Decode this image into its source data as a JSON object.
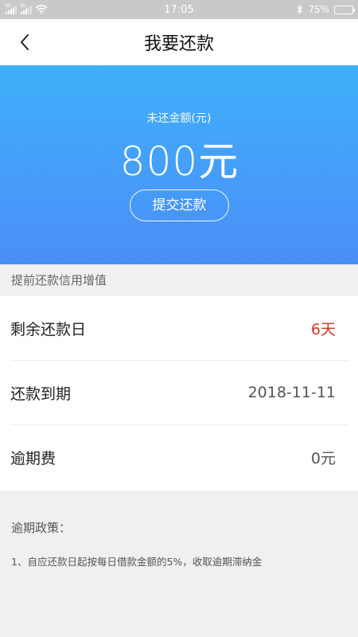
{
  "status_bar": {
    "time": "17:05",
    "battery": "75%",
    "sim1_label": "4G",
    "sim2_label": "3G",
    "battery_level": 0.75,
    "colors": {
      "bar": "#c9c9c9",
      "battery_fill": "#4cd964"
    }
  },
  "nav": {
    "title": "我要还款",
    "back_icon": "chevron-left-icon"
  },
  "hero": {
    "label": "未还金额(元)",
    "amount": "800",
    "unit": "元",
    "submit_label": "提交还款",
    "colors": {
      "gradient_top": "#3fb0fb",
      "gradient_bottom": "#4a8ef6"
    }
  },
  "section": {
    "header": "提前还款信用增值"
  },
  "rows": [
    {
      "label": "剩余还款日",
      "value": "6天"
    },
    {
      "label": "还款到期",
      "value": "2018-11-11"
    },
    {
      "label": "逾期费",
      "value": "0元"
    }
  ],
  "policy": {
    "title": "逾期政策：",
    "items": [
      "1、自应还款日起按每日借款金额的5%，收取逾期滞纳金"
    ]
  },
  "colors": {
    "accent_red": "#d0381f",
    "page_bg": "#f0f0f2"
  }
}
